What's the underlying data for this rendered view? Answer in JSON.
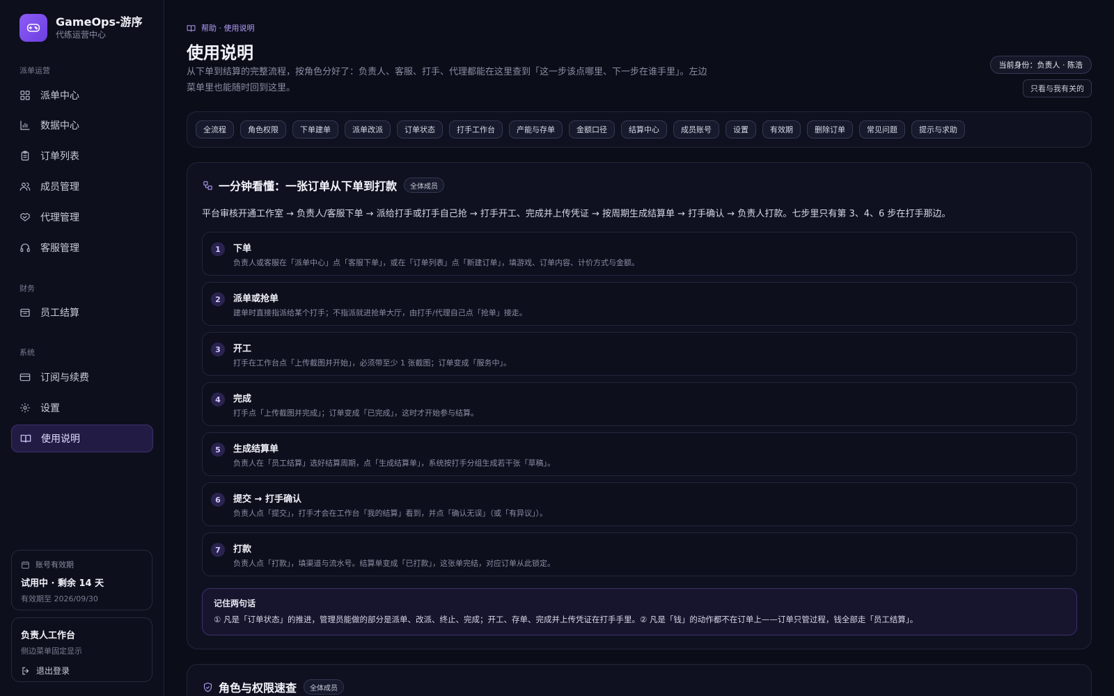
{
  "brand": {
    "name": "GameOps-游序",
    "subtitle": "代练运营中心"
  },
  "sidebar": {
    "sections": [
      {
        "label": "派单运营"
      },
      {
        "label": "财务"
      },
      {
        "label": "系统"
      }
    ],
    "items": [
      {
        "label": "派单中心",
        "icon": "grid-icon"
      },
      {
        "label": "数据中心",
        "icon": "bar-chart-icon"
      },
      {
        "label": "订单列表",
        "icon": "clipboard-icon"
      },
      {
        "label": "成员管理",
        "icon": "users-icon"
      },
      {
        "label": "代理管理",
        "icon": "handshake-icon"
      },
      {
        "label": "客服管理",
        "icon": "headset-icon"
      },
      {
        "label": "员工结算",
        "icon": "wallet-icon"
      },
      {
        "label": "订阅与续费",
        "icon": "credit-card-icon"
      },
      {
        "label": "设置",
        "icon": "gear-icon"
      },
      {
        "label": "使用说明",
        "icon": "book-icon",
        "active": true
      }
    ]
  },
  "account": {
    "label": "账号有效期",
    "status": "试用中 · 剩余 14 天",
    "expiry": "有效期至 2026/09/30"
  },
  "workspace": {
    "title": "负责人工作台",
    "subtitle": "侧边菜单固定显示",
    "logout": "退出登录"
  },
  "header": {
    "breadcrumb": "帮助 · 使用说明",
    "title": "使用说明",
    "description": "从下单到结算的完整流程，按角色分好了：负责人、客服、打手、代理都能在这里查到「这一步该点哪里、下一步在谁手里」。左边菜单里也能随时回到这里。",
    "identity": "当前身份：负责人 · 陈浩",
    "filter_button": "只看与我有关的"
  },
  "tabs": [
    "全流程",
    "角色权限",
    "下单建单",
    "派单改派",
    "订单状态",
    "打手工作台",
    "产能与存单",
    "金额口径",
    "结算中心",
    "成员账号",
    "设置",
    "有效期",
    "删除订单",
    "常见问题",
    "提示与求助"
  ],
  "overview": {
    "title": "一分钟看懂：一张订单从下单到打款",
    "badge": "全体成员",
    "flow": "平台审核开通工作室 → 负责人/客服下单 → 派给打手或打手自己抢 → 打手开工、完成并上传凭证 → 按周期生成结算单 → 打手确认 → 负责人打款。七步里只有第 3、4、6 步在打手那边。",
    "steps": [
      {
        "num": "1",
        "title": "下单",
        "desc": "负责人或客服在「派单中心」点「客服下单」，或在「订单列表」点「新建订单」，填游戏、订单内容、计价方式与金额。"
      },
      {
        "num": "2",
        "title": "派单或抢单",
        "desc": "建单时直接指派给某个打手；不指派就进抢单大厅，由打手/代理自己点「抢单」接走。"
      },
      {
        "num": "3",
        "title": "开工",
        "desc": "打手在工作台点「上传截图并开始」，必须带至少 1 张截图；订单变成「服务中」。"
      },
      {
        "num": "4",
        "title": "完成",
        "desc": "打手点「上传截图并完成」；订单变成「已完成」，这时才开始参与结算。"
      },
      {
        "num": "5",
        "title": "生成结算单",
        "desc": "负责人在「员工结算」选好结算周期，点「生成结算单」，系统按打手分组生成若干张「草稿」。"
      },
      {
        "num": "6",
        "title": "提交 → 打手确认",
        "desc": "负责人点「提交」，打手才会在工作台「我的结算」看到，并点「确认无误」（或「有异议」）。"
      },
      {
        "num": "7",
        "title": "打款",
        "desc": "负责人点「打款」，填渠道与流水号。结算单变成「已打款」，这张单完结，对应订单从此锁定。"
      }
    ],
    "remember_title": "记住两句话",
    "remember_text": "① 凡是「订单状态」的推进，管理员能做的部分是派单、改派、终止、完成；开工、存单、完成并上传凭证在打手手里。② 凡是「钱」的动作都不在订单上——订单只管过程，钱全部走「员工结算」。"
  },
  "roles_section": {
    "title": "角色与权限速查",
    "badge": "全体成员"
  },
  "colors": {
    "accent": "#8b5cf6",
    "background": "#0b0d19",
    "active_nav": "#221c44"
  }
}
